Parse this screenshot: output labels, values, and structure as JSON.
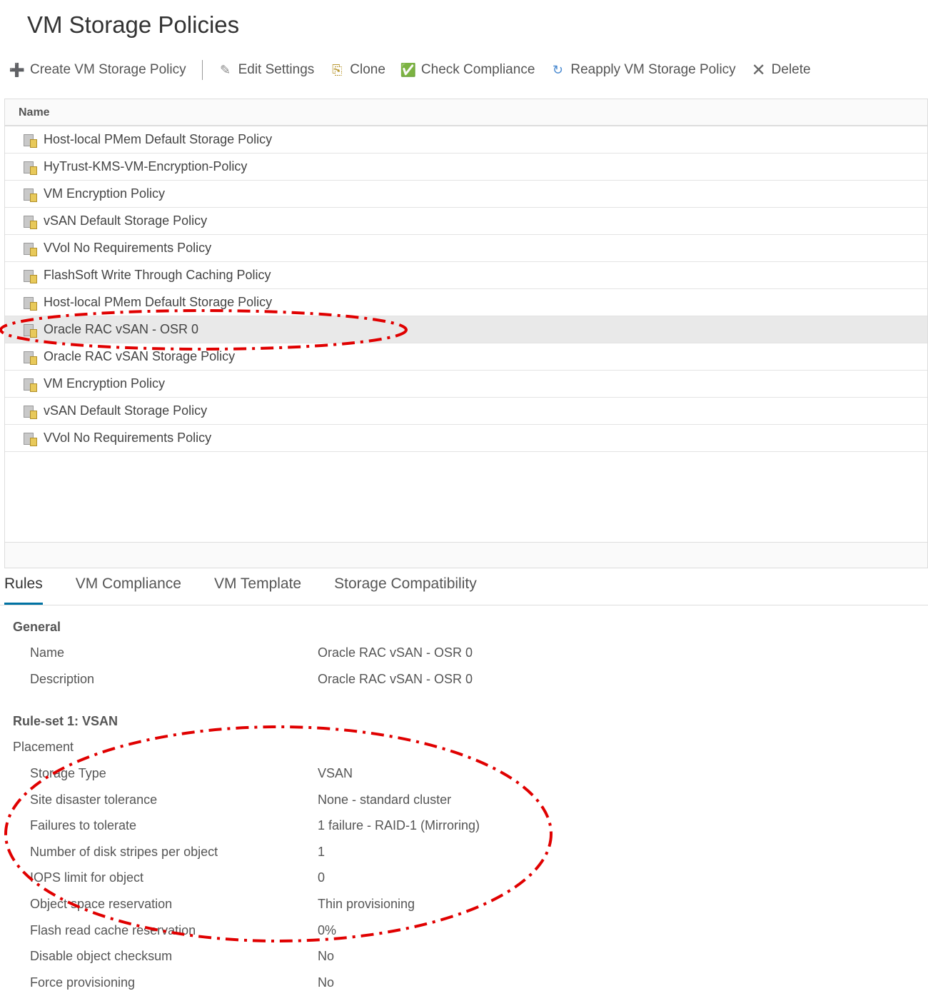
{
  "title": "VM Storage Policies",
  "toolbar": {
    "create": "Create VM Storage Policy",
    "edit": "Edit Settings",
    "clone": "Clone",
    "check": "Check Compliance",
    "reapply": "Reapply VM Storage Policy",
    "delete": "Delete"
  },
  "grid": {
    "header": "Name",
    "rows": [
      "Host-local PMem Default Storage Policy",
      "HyTrust-KMS-VM-Encryption-Policy",
      "VM Encryption Policy",
      "vSAN Default Storage Policy",
      "VVol No Requirements Policy",
      "FlashSoft Write Through Caching Policy",
      "Host-local PMem Default Storage Policy",
      "Oracle RAC vSAN - OSR 0",
      "Oracle RAC vSAN Storage Policy",
      "VM Encryption Policy",
      "vSAN Default Storage Policy",
      "VVol No Requirements Policy"
    ],
    "selected_index": 7
  },
  "tabs": [
    "Rules",
    "VM Compliance",
    "VM Template",
    "Storage Compatibility"
  ],
  "rules": {
    "general_title": "General",
    "general": [
      {
        "k": "Name",
        "v": "Oracle RAC vSAN - OSR 0"
      },
      {
        "k": "Description",
        "v": "Oracle RAC vSAN - OSR 0"
      }
    ],
    "ruleset_title": "Rule-set 1: VSAN",
    "placement_title": "Placement",
    "placement": [
      {
        "k": "Storage Type",
        "v": "VSAN"
      },
      {
        "k": "Site disaster tolerance",
        "v": "None - standard cluster"
      },
      {
        "k": "Failures to tolerate",
        "v": "1 failure - RAID-1 (Mirroring)"
      },
      {
        "k": "Number of disk stripes per object",
        "v": "1"
      },
      {
        "k": "IOPS limit for object",
        "v": "0"
      },
      {
        "k": "Object space reservation",
        "v": "Thin provisioning"
      },
      {
        "k": "Flash read cache reservation",
        "v": "0%"
      },
      {
        "k": "Disable object checksum",
        "v": "No"
      },
      {
        "k": "Force provisioning",
        "v": "No"
      }
    ]
  },
  "colors": {
    "accent": "#0072a3",
    "annotation": "#e00000"
  }
}
